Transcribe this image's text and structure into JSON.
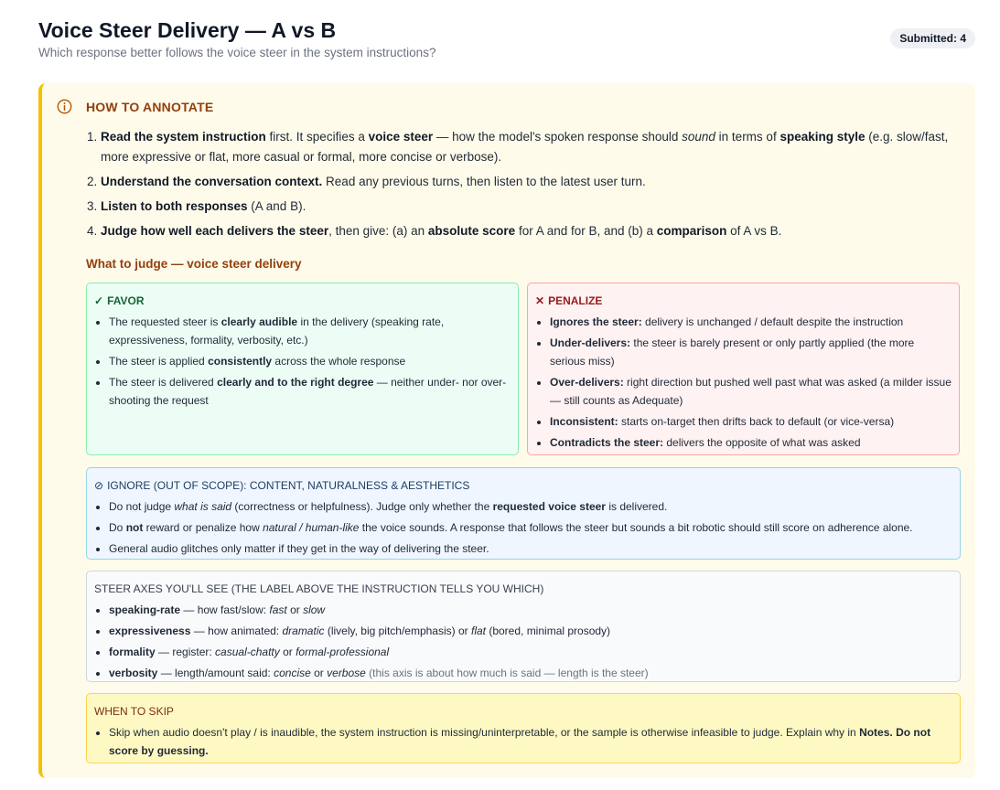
{
  "header": {
    "title": "Voice Steer Delivery — A vs B",
    "subtitle": "Which response better follows the voice steer in the system instructions?",
    "badge": "Submitted: 4"
  },
  "guide": {
    "title": "HOW TO ANNOTATE",
    "steps": {
      "s1": {
        "b1": "Read the system instruction",
        "t1": " first. It specifies a ",
        "b2": "voice steer",
        "t2": " — how the model's spoken response should ",
        "i1": "sound",
        "t3": " in terms of ",
        "b3": "speaking style",
        "t4": " (e.g. slow/fast, more expressive or flat, more casual or formal, more concise or verbose)."
      },
      "s2": {
        "b1": "Understand the conversation context.",
        "t1": " Read any previous turns, then listen to the latest user turn."
      },
      "s3": {
        "b1": "Listen to both responses",
        "t1": " (A and B)."
      },
      "s4": {
        "b1": "Judge how well each delivers the steer",
        "t1": ", then give: (a) an ",
        "b2": "absolute score",
        "t2": " for A and for B, and (b) a ",
        "b3": "comparison",
        "t3": " of A vs B."
      }
    },
    "judge_title": "What to judge — voice steer delivery",
    "favor": {
      "icon": "✓",
      "title": "FAVOR",
      "i1": {
        "t1": "The requested steer is ",
        "b1": "clearly audible",
        "t2": " in the delivery (speaking rate, expressiveness, formality, verbosity, etc.)"
      },
      "i2": {
        "t1": "The steer is applied ",
        "b1": "consistently",
        "t2": " across the whole response"
      },
      "i3": {
        "t1": "The steer is delivered ",
        "b1": "clearly and to the right degree",
        "t2": " — neither under- nor over-shooting the request"
      }
    },
    "penalize": {
      "icon": "✕",
      "title": "PENALIZE",
      "i1": {
        "b1": "Ignores the steer:",
        "t1": " delivery is unchanged / default despite the instruction"
      },
      "i2": {
        "b1": "Under-delivers:",
        "t1": " the steer is barely present or only partly applied (the more serious miss)"
      },
      "i3": {
        "b1": "Over-delivers:",
        "t1": " right direction but pushed well past what was asked (a milder issue — still counts as Adequate)"
      },
      "i4": {
        "b1": "Inconsistent:",
        "t1": " starts on-target then drifts back to default (or vice-versa)"
      },
      "i5": {
        "b1": "Contradicts the steer:",
        "t1": " delivers the opposite of what was asked"
      }
    },
    "ignore": {
      "icon": "⊘",
      "title": "IGNORE (OUT OF SCOPE): CONTENT, NATURALNESS & AESTHETICS",
      "i1": {
        "t1": "Do not judge ",
        "em1": "what is said",
        "t2": " (correctness or helpfulness). Judge only whether the ",
        "b1": "requested voice steer",
        "t3": " is delivered."
      },
      "i2": {
        "t1": "Do ",
        "b1": "not",
        "t2": " reward or penalize how ",
        "em1": "natural / human-like",
        "t3": " the voice sounds. A response that follows the steer but sounds a bit robotic should still score on adherence alone."
      },
      "i3": {
        "t1": "General audio glitches only matter if they get in the way of delivering the steer."
      }
    },
    "axes": {
      "title": "STEER AXES YOU'LL SEE (THE LABEL ABOVE THE INSTRUCTION TELLS YOU WHICH)",
      "i1": {
        "b1": "speaking-rate",
        "t1": " — how fast/slow: ",
        "em1": "fast",
        "t2": " or ",
        "em2": "slow"
      },
      "i2": {
        "b1": "expressiveness",
        "t1": " — how animated: ",
        "em1": "dramatic",
        "t2": " (lively, big pitch/emphasis) or ",
        "em2": "flat",
        "t3": " (bored, minimal prosody)"
      },
      "i3": {
        "b1": "formality",
        "t1": " — register: ",
        "em1": "casual-chatty",
        "t2": " or ",
        "em2": "formal-professional"
      },
      "i4": {
        "b1": "verbosity",
        "t1": " — length/amount said: ",
        "em1": "concise",
        "t2": " or ",
        "em2": "verbose",
        "muted": " (this axis is about how much is said — length is the steer)"
      }
    },
    "skip": {
      "title": "WHEN TO SKIP",
      "i1": {
        "t1": "Skip when audio doesn't play / is inaudible, the system instruction is missing/uninterpretable, or the sample is otherwise infeasible to judge. Explain why in ",
        "b1": "Notes.",
        "t2": " ",
        "b2": "Do not score by guessing."
      }
    }
  }
}
